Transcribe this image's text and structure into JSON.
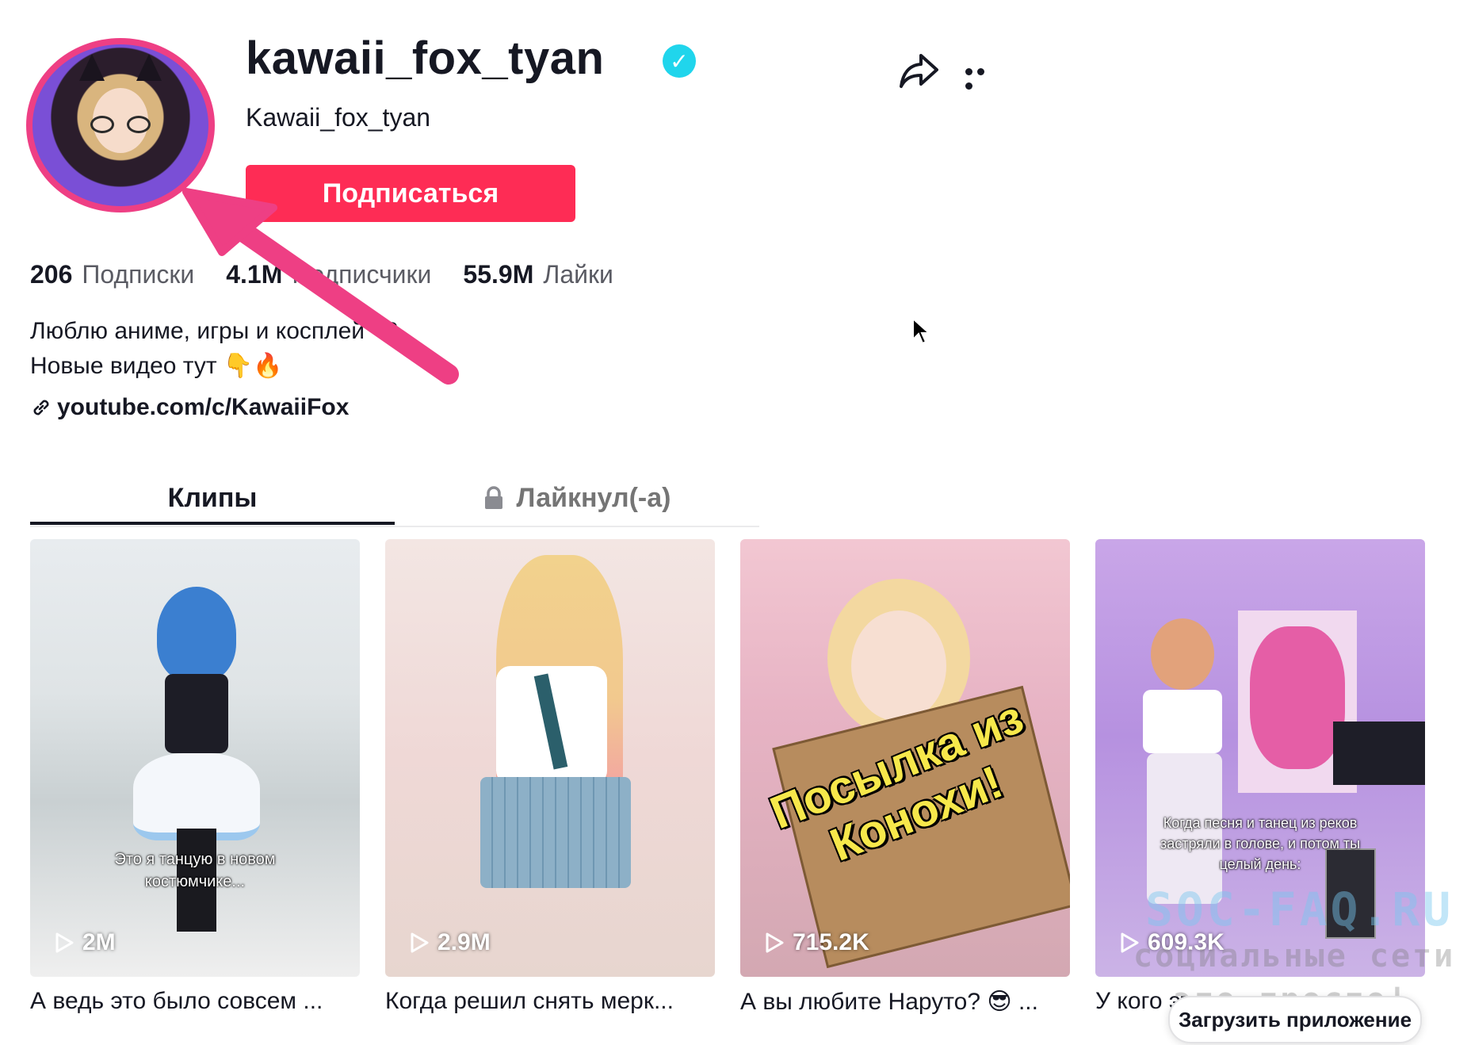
{
  "profile": {
    "username": "kawaii_fox_tyan",
    "nickname": "Kawaii_fox_tyan",
    "verified": true,
    "follow_label": "Подписаться",
    "stats": [
      {
        "value": "206",
        "label": "Подписки"
      },
      {
        "value": "4.1M",
        "label": "Подписчики"
      },
      {
        "value": "55.9M",
        "label": "Лайки"
      }
    ],
    "bio_line1": "Люблю аниме, игры и косплей <3",
    "bio_line2": "Новые видео тут 👇🔥",
    "link": "youtube.com/c/KawaiiFox"
  },
  "tabs": [
    {
      "label": "Клипы",
      "active": true
    },
    {
      "label": "Лайкнул(-а)",
      "locked": true
    }
  ],
  "videos": [
    {
      "views": "2M",
      "overlay": "Это я танцую в новом костюмчике...",
      "title": "А ведь это было совсем ..."
    },
    {
      "views": "2.9M",
      "overlay": "",
      "title": "Когда решил снять мерк..."
    },
    {
      "views": "715.2K",
      "overlay": "Посылка из Конохи!",
      "title": "А вы любите Наруто? 😎 ..."
    },
    {
      "views": "609.3K",
      "overlay": "Когда песня и танец из реков застряли в голове, и потом ты целый день:",
      "title": "У кого это ..."
    }
  ],
  "watermark": {
    "line1": "SOC-FAQ.RU",
    "line2": "социальные сети",
    "line3": "это просто!"
  },
  "download_app": "Загрузить приложение",
  "colors": {
    "follow_button": "#fe2c55",
    "verified_badge": "#20d5ec",
    "annotation_arrow": "#ee3f84"
  }
}
